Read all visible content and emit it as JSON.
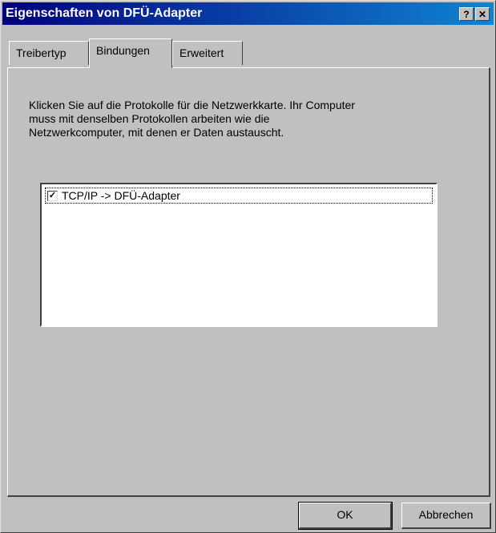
{
  "window": {
    "title": "Eigenschaften von DFÜ-Adapter",
    "help_label": "?",
    "close_label": "✕"
  },
  "tabs": [
    {
      "label": "Treibertyp",
      "active": false
    },
    {
      "label": "Bindungen",
      "active": true
    },
    {
      "label": "Erweitert",
      "active": false
    }
  ],
  "bindings": {
    "description": "Klicken Sie auf die Protokolle für die Netzwerkkarte. Ihr Computer\nmuss mit denselben Protokollen arbeiten wie die\nNetzwerkcomputer, mit denen er Daten austauscht.",
    "items": [
      {
        "label": "TCP/IP -> DFÜ-Adapter",
        "checked": true,
        "check_glyph": "✓"
      }
    ]
  },
  "buttons": {
    "ok_label": "OK",
    "cancel_label": "Abbrechen"
  }
}
